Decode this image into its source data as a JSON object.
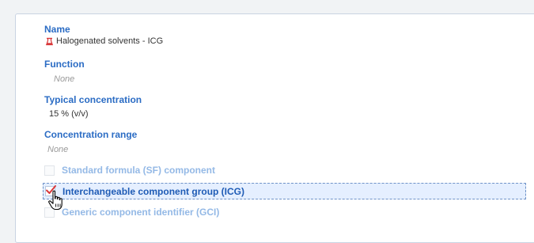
{
  "details": {
    "name_label": "Name",
    "name_value": "Halogenated solvents - ICG",
    "name_icon": "substance-flask-icon",
    "function_label": "Function",
    "function_value": "None",
    "typical_concentration_label": "Typical concentration",
    "typical_concentration_value": "15 % (v/v)",
    "concentration_range_label": "Concentration range",
    "concentration_range_value": "None"
  },
  "component_types": [
    {
      "label": "Standard formula (SF) component",
      "checked": false
    },
    {
      "label": "Interchangeable component group (ICG)",
      "checked": true,
      "focused": true
    },
    {
      "label": "Generic component identifier (GCI)",
      "checked": false
    }
  ],
  "colors": {
    "label_blue": "#2b6cc4",
    "disabled_blue": "#94b9e6",
    "focus_background": "#e5efff",
    "checkmark_red": "#d9383a"
  },
  "cursor": "hand-pointer-icon"
}
